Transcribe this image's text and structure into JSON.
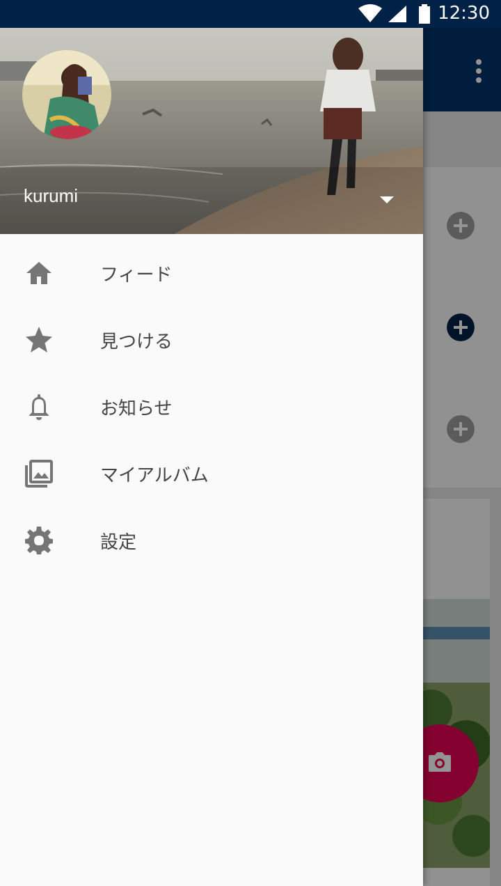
{
  "status_bar": {
    "time": "12:30"
  },
  "drawer": {
    "username": "kurumi",
    "items": [
      {
        "label": "フィード",
        "icon": "home-icon"
      },
      {
        "label": "見つける",
        "icon": "star-icon"
      },
      {
        "label": "お知らせ",
        "icon": "bell-icon"
      },
      {
        "label": "マイアルバム",
        "icon": "photo-library-icon"
      },
      {
        "label": "設定",
        "icon": "gear-icon"
      }
    ]
  },
  "colors": {
    "status_bar": "#012146",
    "toolbar": "#023269",
    "fab": "#e40050",
    "drawer_bg": "#fafafa",
    "icon": "#757575"
  }
}
